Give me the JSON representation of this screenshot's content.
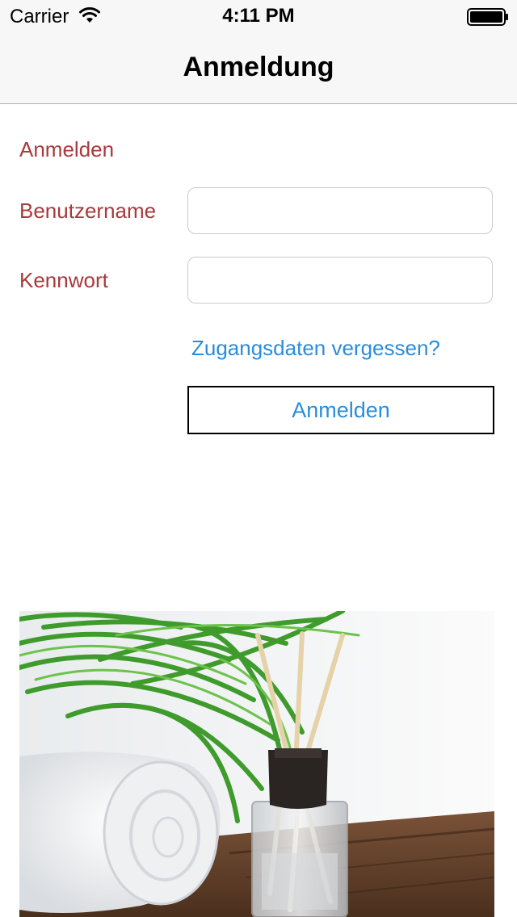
{
  "status_bar": {
    "carrier": "Carrier",
    "time": "4:11 PM",
    "wifi_icon": "wifi-icon",
    "battery_icon": "battery-icon"
  },
  "nav": {
    "title": "Anmeldung"
  },
  "form": {
    "section_title": "Anmelden",
    "username_label": "Benutzername",
    "username_value": "",
    "password_label": "Kennwort",
    "password_value": "",
    "forgot_link": "Zugangsdaten vergessen?",
    "submit_label": "Anmelden"
  },
  "image": {
    "subject": "spa-towel-diffuser-photo"
  },
  "colors": {
    "label_red": "#a73a3c",
    "link_blue": "#2a8ddc",
    "nav_background": "#f7f7f7"
  }
}
